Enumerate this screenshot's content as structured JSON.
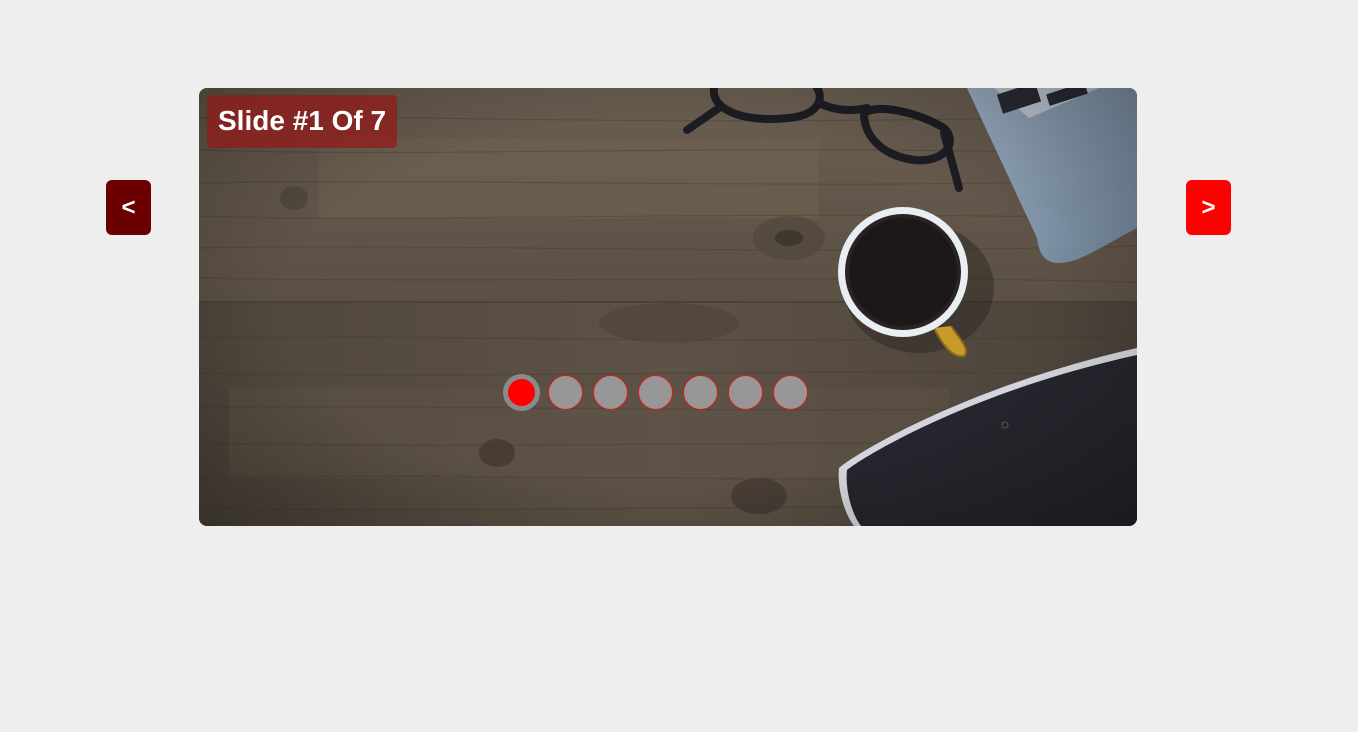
{
  "slider": {
    "caption": "Slide #1 Of 7",
    "prev_label": "<",
    "next_label": ">",
    "current_slide": 1,
    "total_slides": 7,
    "image_description_icon": "desk-photo-image",
    "colors": {
      "background": "#eeeeee",
      "prev_button": "#6b0000",
      "next_button": "#ff0000",
      "active_dot": "#ff0000",
      "inactive_dot": "#979797",
      "dot_border": "#e01616"
    }
  },
  "dots": [
    {
      "index": 1,
      "active": true
    },
    {
      "index": 2,
      "active": false
    },
    {
      "index": 3,
      "active": false
    },
    {
      "index": 4,
      "active": false
    },
    {
      "index": 5,
      "active": false
    },
    {
      "index": 6,
      "active": false
    },
    {
      "index": 7,
      "active": false
    }
  ]
}
